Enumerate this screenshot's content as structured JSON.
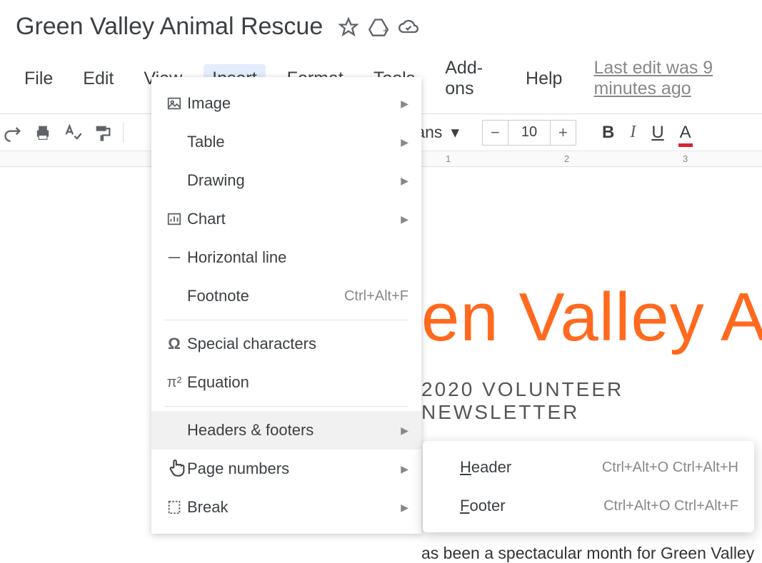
{
  "header": {
    "doc_title": "Green Valley Animal Rescue",
    "last_edit": "Last edit was 9 minutes ago"
  },
  "menubar": {
    "file": "File",
    "edit": "Edit",
    "view": "View",
    "insert": "Insert",
    "format": "Format",
    "tools": "Tools",
    "addons": "Add-ons",
    "help": "Help"
  },
  "toolbar": {
    "font_name": "Sans",
    "font_size": "10"
  },
  "ruler": {
    "n1": "1",
    "n2": "2",
    "n3": "3"
  },
  "insert_menu": {
    "image": "Image",
    "table": "Table",
    "drawing": "Drawing",
    "chart": "Chart",
    "hline": "Horizontal line",
    "footnote": "Footnote",
    "footnote_sc": "Ctrl+Alt+F",
    "special": "Special characters",
    "equation": "Equation",
    "headers_footers": "Headers & footers",
    "page_numbers": "Page numbers",
    "break": "Break"
  },
  "submenu": {
    "header": "eader",
    "header_sc": "Ctrl+Alt+O Ctrl+Alt+H",
    "footer": "ooter",
    "footer_sc": "Ctrl+Alt+O Ctrl+Alt+F"
  },
  "document": {
    "title_visible": "en Valley Ani",
    "subtitle": "2020 VOLUNTEER NEWSLETTER",
    "paragraph": "as been a spectacular month for Green Valley"
  }
}
